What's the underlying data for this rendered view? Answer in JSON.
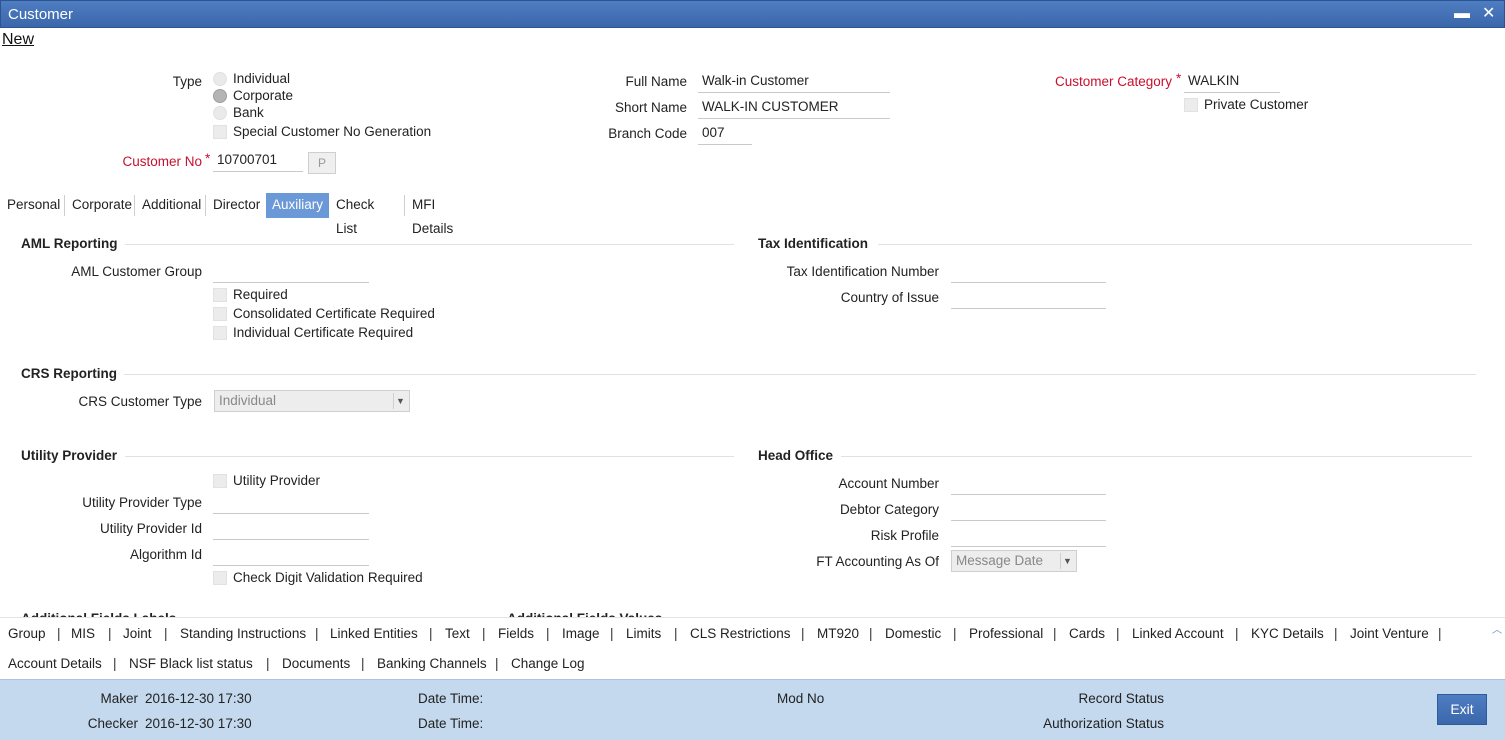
{
  "window": {
    "title": "Customer",
    "minimize_glyph": "▬",
    "close_glyph": "✕"
  },
  "menu": {
    "new_label": "New"
  },
  "header": {
    "type_label": "Type",
    "type_options": [
      "Individual",
      "Corporate",
      "Bank"
    ],
    "type_selected": "Corporate",
    "special_customer_no_label": "Special Customer No Generation",
    "customer_no_label": "Customer No",
    "customer_no_value": "10700701",
    "p_button_label": "P",
    "full_name_label": "Full Name",
    "full_name_value": "Walk-in Customer",
    "short_name_label": "Short Name",
    "short_name_value": "WALK-IN CUSTOMER",
    "branch_code_label": "Branch Code",
    "branch_code_value": "007",
    "customer_category_label": "Customer Category",
    "customer_category_value": "WALKIN",
    "private_customer_label": "Private Customer",
    "required_mark": "*"
  },
  "tabs": [
    {
      "label": "Personal"
    },
    {
      "label": "Corporate"
    },
    {
      "label": "Additional"
    },
    {
      "label": "Director"
    },
    {
      "label": "Auxiliary",
      "active": true
    },
    {
      "label": "Check List"
    },
    {
      "label": "MFI Details"
    }
  ],
  "aml": {
    "heading": "AML Reporting",
    "group_label": "AML Customer Group",
    "group_value": "",
    "required_label": "Required",
    "consolidated_label": "Consolidated Certificate Required",
    "individual_label": "Individual Certificate Required"
  },
  "tax": {
    "heading": "Tax Identification",
    "tin_label": "Tax Identification Number",
    "country_label": "Country of Issue"
  },
  "crs": {
    "heading": "CRS Reporting",
    "type_label": "CRS Customer Type",
    "type_value": "Individual"
  },
  "utility": {
    "heading": "Utility Provider",
    "provider_label": "Utility Provider",
    "provider_type_label": "Utility Provider Type",
    "provider_id_label": "Utility Provider Id",
    "algorithm_label": "Algorithm Id",
    "check_digit_label": "Check Digit Validation Required"
  },
  "head_office": {
    "heading": "Head Office",
    "account_label": "Account Number",
    "debtor_label": "Debtor Category",
    "risk_label": "Risk Profile",
    "ft_label": "FT Accounting As Of",
    "ft_value": "Message Date"
  },
  "cut_headings": [
    "Additional Fields Labels",
    "Additional Fields Values"
  ],
  "bottom_links": {
    "row1": [
      "Group",
      "MIS",
      "Joint",
      "Standing Instructions",
      "Linked Entities",
      "Text",
      "Fields",
      "Image",
      "Limits",
      "CLS Restrictions",
      "MT920",
      "Domestic",
      "Professional",
      "Cards",
      "Linked Account",
      "KYC Details",
      "Joint Venture"
    ],
    "row2": [
      "Account Details",
      "NSF Black list status",
      "Documents",
      "Banking Channels",
      "Change Log"
    ],
    "separator": "|"
  },
  "footer": {
    "maker_label": "Maker",
    "maker_value": "2016-12-30 17:30",
    "checker_label": "Checker",
    "checker_value": "2016-12-30 17:30",
    "date_time_label": "Date Time:",
    "mod_no_label": "Mod No",
    "record_status_label": "Record Status",
    "auth_status_label": "Authorization Status",
    "exit_label": "Exit"
  }
}
